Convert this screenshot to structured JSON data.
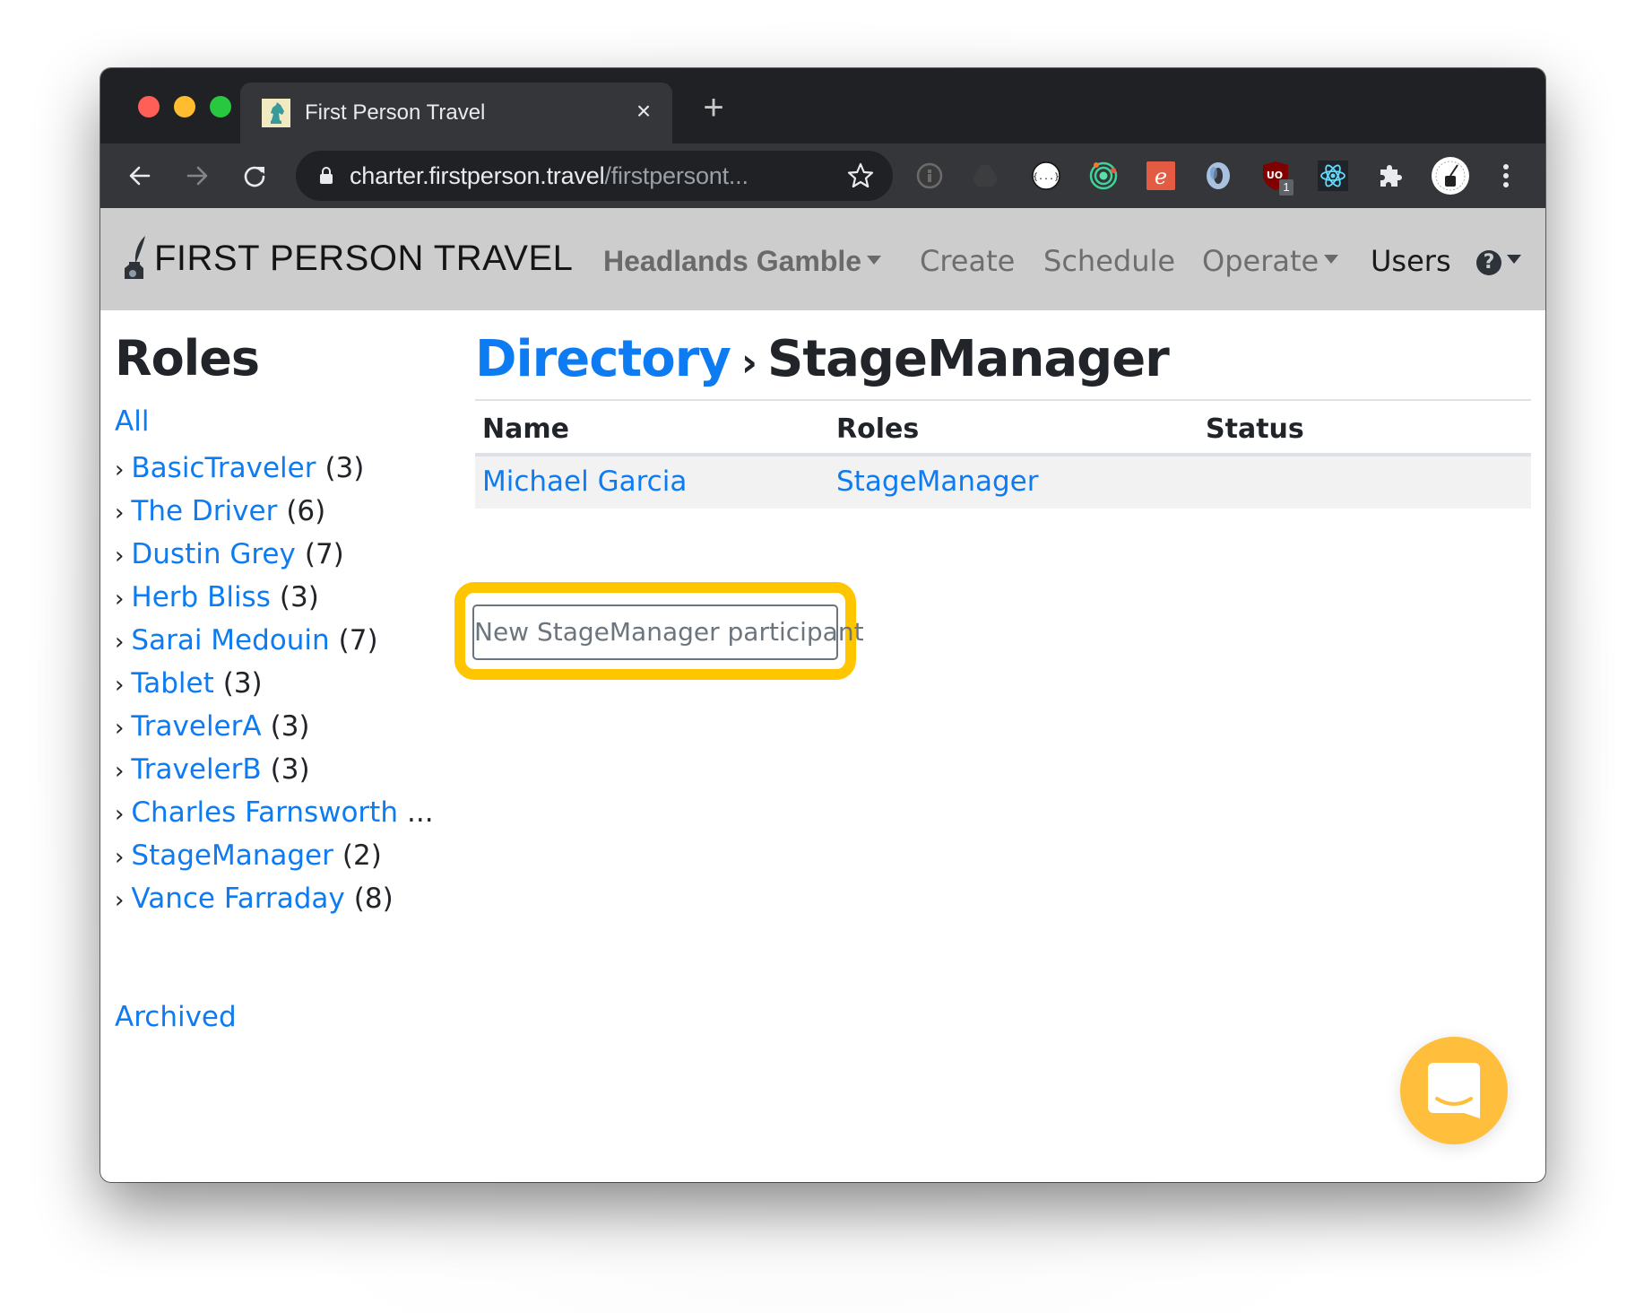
{
  "browser": {
    "tab": {
      "title": "First Person Travel",
      "favicon": "chess-knight-icon",
      "close_label": "×"
    },
    "new_tab_label": "+",
    "nav": {
      "back": "back-arrow-icon",
      "forward": "forward-arrow-icon",
      "reload": "reload-icon"
    },
    "address": {
      "host": "charter.firstperson.travel",
      "path": "/firstpersont..."
    },
    "extensions": [
      {
        "name": "info-extension-icon"
      },
      {
        "name": "drive-extension-icon"
      },
      {
        "name": "json-formatter-extension-icon",
        "label": "{...}"
      },
      {
        "name": "orbit-extension-icon"
      },
      {
        "name": "e-extension-icon",
        "label": "e"
      },
      {
        "name": "ring-extension-icon"
      },
      {
        "name": "ublock-extension-icon",
        "label": "UO",
        "badge": "1"
      },
      {
        "name": "react-devtools-extension-icon"
      },
      {
        "name": "puzzle-extensions-icon"
      },
      {
        "name": "profile-avatar-icon"
      },
      {
        "name": "kebab-menu-icon"
      }
    ]
  },
  "navbar": {
    "brand": "FIRST PERSON TRAVEL",
    "project": "Headlands Gamble",
    "items": [
      {
        "label": "Create"
      },
      {
        "label": "Schedule"
      },
      {
        "label": "Operate"
      },
      {
        "label": "Users"
      }
    ],
    "help": "?"
  },
  "sidebar": {
    "title": "Roles",
    "all_label": "All",
    "chevron": "›",
    "roles": [
      {
        "name": "BasicTraveler",
        "count": "(3)"
      },
      {
        "name": "The Driver",
        "count": "(6)"
      },
      {
        "name": "Dustin Grey",
        "count": "(7)"
      },
      {
        "name": "Herb Bliss",
        "count": "(3)"
      },
      {
        "name": "Sarai Medouin",
        "count": "(7)"
      },
      {
        "name": "Tablet",
        "count": "(3)"
      },
      {
        "name": "TravelerA",
        "count": "(3)"
      },
      {
        "name": "TravelerB",
        "count": "(3)"
      },
      {
        "name": "Charles Farnsworth",
        "count": "..."
      },
      {
        "name": "StageManager",
        "count": "(2)"
      },
      {
        "name": "Vance Farraday",
        "count": "(8)"
      }
    ],
    "archived_label": "Archived"
  },
  "main": {
    "breadcrumb_root": "Directory",
    "breadcrumb_sep": "›",
    "breadcrumb_current": "StageManager",
    "table": {
      "headers": [
        "Name",
        "Roles",
        "Status"
      ],
      "rows": [
        {
          "name": "Michael Garcia",
          "roles": "StageManager",
          "status": ""
        }
      ]
    },
    "new_button_label": "New StageManager participant"
  },
  "colors": {
    "link": "#0d7bf2",
    "highlight": "#ffc600",
    "chat": "#ffbf3c",
    "navbar_bg": "#cdcdcd"
  }
}
